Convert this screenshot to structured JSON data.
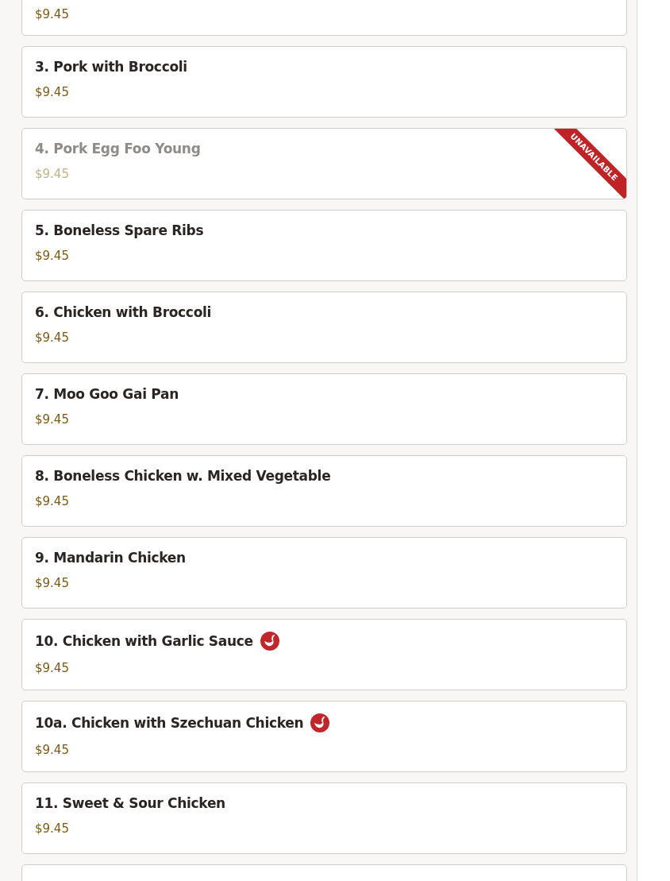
{
  "items": [
    {
      "kind": "partial",
      "price": "$9.45",
      "available": true
    },
    {
      "name": "3. Pork with Broccoli",
      "price": "$9.45",
      "spicy": false,
      "available": true
    },
    {
      "name": "4. Pork Egg Foo Young",
      "price": "$9.45",
      "spicy": false,
      "available": false,
      "badge": "UNAVAILABLE"
    },
    {
      "name": "5. Boneless Spare Ribs",
      "price": "$9.45",
      "spicy": false,
      "available": true
    },
    {
      "name": "6. Chicken with Broccoli",
      "price": "$9.45",
      "spicy": false,
      "available": true
    },
    {
      "name": "7. Moo Goo Gai Pan",
      "price": "$9.45",
      "spicy": false,
      "available": true
    },
    {
      "name": "8. Boneless Chicken w. Mixed Vegetable",
      "price": "$9.45",
      "spicy": false,
      "available": true
    },
    {
      "name": "9. Mandarin Chicken",
      "price": "$9.45",
      "spicy": false,
      "available": true
    },
    {
      "name": "10. Chicken with Garlic Sauce",
      "price": "$9.45",
      "spicy": true,
      "available": true
    },
    {
      "name": "10a. Chicken with Szechuan Chicken",
      "price": "$9.45",
      "spicy": true,
      "available": true
    },
    {
      "name": "11. Sweet & Sour Chicken",
      "price": "$9.45",
      "spicy": false,
      "available": true
    }
  ]
}
